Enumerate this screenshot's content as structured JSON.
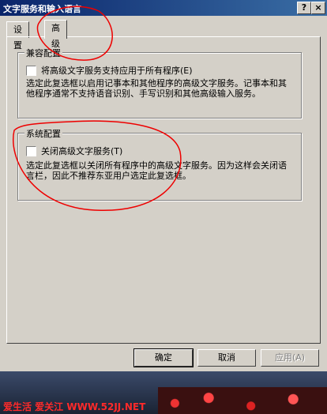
{
  "window": {
    "title": "文字服务和输入语言",
    "help_btn": "?",
    "close_btn": "×"
  },
  "tabs": [
    {
      "label": "设置"
    },
    {
      "label": "高级"
    }
  ],
  "compat": {
    "title": "兼容配置",
    "checkbox_label": "将高级文字服务支持应用于所有程序(E)",
    "desc": "选定此复选框以启用记事本和其他程序的高级文字服务。记事本和其他程序通常不支持语音识别、手写识别和其他高级输入服务。"
  },
  "system": {
    "title": "系统配置",
    "checkbox_label": "关闭高级文字服务(T)",
    "desc": "选定此复选框以关闭所有程序中的高级文字服务。因为这样会关闭语言栏，因此不推荐东亚用户选定此复选框。"
  },
  "buttons": {
    "ok": "确定",
    "cancel": "取消",
    "apply": "应用(A)"
  },
  "watermark": "爱生活 爱关江 WWW.52JJ.NET"
}
